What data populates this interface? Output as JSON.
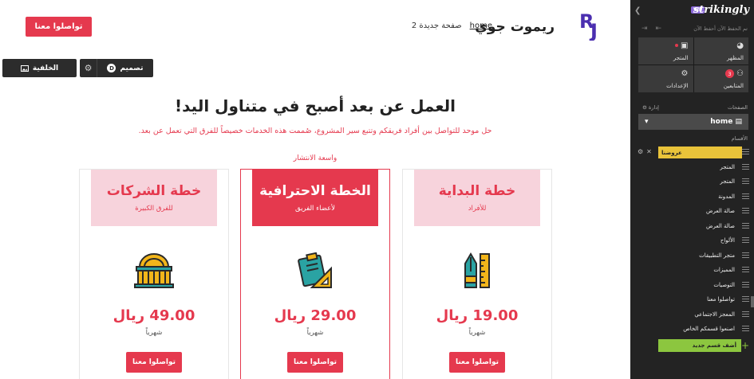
{
  "site": {
    "name": "ريموت جوي",
    "nav_home": "home",
    "nav_page2": "صفحة جديدة 2",
    "contact_button": "تواصلوا معنا"
  },
  "toolbar": {
    "background_label": "الخلفية",
    "design_label": "تصميم",
    "design_badge": "D"
  },
  "hero": {
    "headline": "العمل عن بعد أصبح في متناول اليد!",
    "subline": "حل موحد للتواصل بين أفراد فريقكم وتتبع سير المشروع، صُممت هذه الخدمات خصيصاً للفرق التي تعمل عن بعد."
  },
  "pricing": {
    "popular_tag": "واسعة الانتشار",
    "plans": [
      {
        "name": "خطة البداية",
        "subtitle": "للأفراد",
        "price": "19.00 ريال",
        "period": "شهرياً",
        "button": "تواصلوا معنا",
        "icon": "pen-ruler-icon"
      },
      {
        "name": "الخطة الاحترافية",
        "subtitle": "لأعضاء الفريق",
        "price": "29.00 ريال",
        "period": "شهرياً",
        "button": "تواصلوا معنا",
        "icon": "clipboard-ruler-icon"
      },
      {
        "name": "خطة الشركات",
        "subtitle": "للفرق الكبيرة",
        "price": "49.00 ريال",
        "period": "شهرياً",
        "button": "تواصلوا معنا",
        "icon": "building-icon"
      }
    ]
  },
  "editor": {
    "brand": "strikingly",
    "vip": "VIP",
    "saved_note": "تم الحفظ الآن أحفظ الآن",
    "tiles": [
      {
        "label": "المظهر",
        "icon": "palette-icon"
      },
      {
        "label": "المتجر",
        "icon": "store-icon"
      },
      {
        "label": "المتابعين",
        "icon": "audience-icon",
        "count": "3"
      },
      {
        "label": "الإعدادات",
        "icon": "gear-icon"
      }
    ],
    "pages_label": "الصفحات",
    "manage_label": "إدارة",
    "current_page": "home",
    "sections_label": "الأقسام",
    "sections": [
      "عروضنا",
      "المتجر",
      "المتجر",
      "المدونة",
      "صالة العرض",
      "صالة العرض",
      "الألواح",
      "متجر التطبيقات",
      "المميزات",
      "التوصيات",
      "تواصلوا معنا",
      "المعجز الاجتماعي",
      "اصنعوا قسمكم الخاص"
    ],
    "add_section": "أضف قسم جديد"
  },
  "colors": {
    "accent": "#e5394e",
    "accent_light": "#f7d3dc",
    "icon_yellow": "#f2b51a",
    "icon_teal": "#2aa3a3",
    "sidebar_bg": "#232323",
    "active_section": "#e9c33a",
    "add_green": "#8cc63f"
  }
}
